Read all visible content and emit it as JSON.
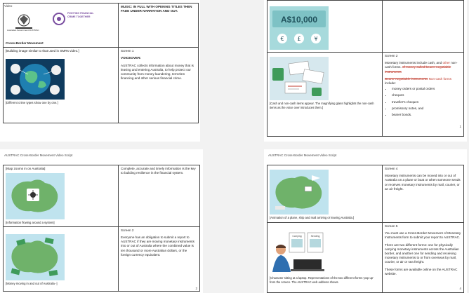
{
  "page1": {
    "header": "Video",
    "logo_left_text": "Australian Government AUSTRAC",
    "logo_right_text": "FIGHTING FINANCIAL CRIME TOGETHER",
    "section_title": "Cross-Border Movement",
    "music_note": "MUSIC: IN FULL WITH OPENING TITLES THEN FADE UNDER NARRATION AND OUT.",
    "screen_label": "Screen 1",
    "image_note": "[Building image similar to that used in SMRs video.]",
    "voiceover_label": "VOICEOVER:",
    "voiceover_text": "AUSTRAC collects information about money that is leaving and entering Australia, to help protect our community from money laundering, terrorism financing and other serious financial crime.",
    "caption": "[Different crime types show one by one.]"
  },
  "page2": {
    "banknote_text": "A$10,000",
    "currency_symbols": [
      "€",
      "£",
      "¥"
    ],
    "screen_label": "Screen 2",
    "text1_a": "Monetary instruments include cash, and",
    "text1_other": "other",
    "text1_b": "non-cash forms.",
    "text1_strike": "of money called bearer negotiable instruments",
    "text2_strike": "Bearer negotiable instruments",
    "text2_red": "Non-cash forms",
    "text2_b": "include:",
    "items": [
      "money orders or postal orders",
      "cheques",
      "traveller's cheques",
      "promissory notes, and",
      "bearer bonds."
    ],
    "caption": "[Cash and non-cash items appear. The magnifying glass highlights the non-cash items as the voice over introduces them.]",
    "page_number": "1"
  },
  "page3": {
    "header": "AUSTRAC Cross-Border Movement Video Script",
    "caption_top": "[Map zooms in on Australia]",
    "text1": "Complete, accurate and timely information is the key to building resilience in the financial system.",
    "caption_mid": "[Information flowing around a system]",
    "screen_label": "Screen 2",
    "text2": "Everyone has an obligation to submit a report to AUSTRAC if they are moving monetary instruments into or out of Australia where the combined value is ten thousand or more Australian dollars, or the foreign currency equivalent.",
    "caption_bottom": "[Money moving in and out of Australia -]",
    "page_number": "2"
  },
  "page4": {
    "header": "AUSTRAC Cross-Border Movement Video Script",
    "screen4_label": "Screen 4",
    "text4": "Monetary instruments can be moved into or out of Australia on a plane or boat or when someone sends or receives monetary instruments by mail, courier, or an air freight.",
    "caption_top": "[Animation of a plane, ship and mail arriving or leaving Australia.]",
    "screen5_label": "Screen 5",
    "text5a": "You must use a Cross-Border Movement of Monetary Instruments form to submit your report to AUSTRAC.",
    "text5b": "There are two different forms: one for physically carrying monetary instruments across the Australian border, and another one for sending and receiving monetary instruments to or from overseas by mail, courier, or air or sea freight.",
    "text5c": "These forms are available online on the AUSTRAC website.",
    "caption_bottom": "[Character sitting at a laptop. Representations of the two different forms 'pop up' from the screen. The AUSTRAC web address shows.",
    "form_labels": [
      "Carrying",
      "Sending"
    ],
    "page_number": "4"
  },
  "colors": {
    "ocean": "#bfe3ee",
    "land": "#6fb26a",
    "teal": "#5aa9b5",
    "red_text": "#c0392b"
  }
}
